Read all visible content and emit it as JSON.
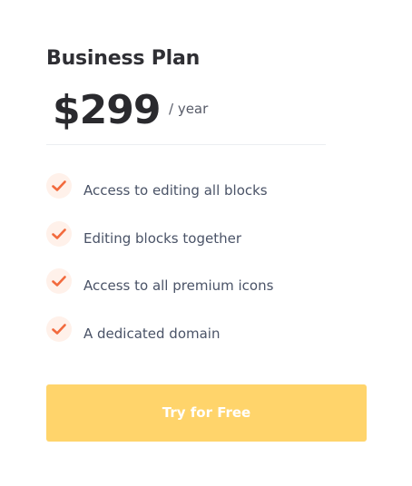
{
  "plan": {
    "title": "Business Plan",
    "price": "$299",
    "period": "/ year"
  },
  "features": [
    {
      "label": "Access to editing all blocks",
      "icon": "check-icon"
    },
    {
      "label": "Editing blocks together",
      "icon": "check-icon"
    },
    {
      "label": "Access to all premium icons",
      "icon": "check-icon"
    },
    {
      "label": "A dedicated domain",
      "icon": "check-icon"
    }
  ],
  "cta": {
    "label": "Try for Free"
  },
  "colors": {
    "accent": "#f26a3d",
    "check_bg": "#fff1ea",
    "button_bg": "#ffd46b",
    "title": "#2f2f34",
    "text": "#4a5367"
  }
}
